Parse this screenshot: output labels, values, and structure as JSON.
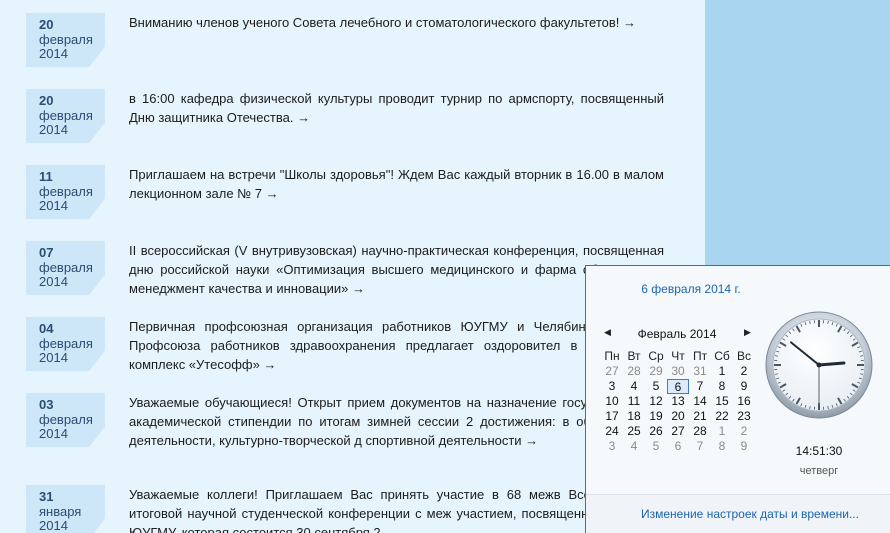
{
  "news": [
    {
      "day": "20",
      "month": "февраля",
      "year": "2014",
      "text": "Вниманию членов ученого Совета лечебного и стоматологического факультетов! →"
    },
    {
      "day": "20",
      "month": "февраля",
      "year": "2014",
      "text": "в 16:00 кафедра физической культуры проводит турнир по армспорту, посвященный Дню защитника Отечества. →"
    },
    {
      "day": "11",
      "month": "февраля",
      "year": "2014",
      "text": "Приглашаем на встречи \"Школы здоровья\"! Ждем Вас каждый вторник в 16.00 в малом лекционном зале № 7 →"
    },
    {
      "day": "07",
      "month": "февраля",
      "year": "2014",
      "text": "II всероссийская (V внутривузовская) научно-практическая конференция, посвященная дню российской науки «Оптимизация высшего медицинского и фарма образования: менеджмент качества и инновации» →"
    },
    {
      "day": "04",
      "month": "февраля",
      "year": "2014",
      "text": "Первичная профсоюзная организация работников ЮУГМУ и Челябински Комитет Профсоюза работников здравоохранения предлагает оздоровител в гостиничный комплекс «Утесофф» →"
    },
    {
      "day": "03",
      "month": "февраля",
      "year": "2014",
      "text": "Уважаемые обучающиеся! Открыт прием документов на назначение государственной академической стипендии по итогам зимней сессии 2 достижения: в общественной деятельности, культурно-творческой д спортивной деятельности →"
    },
    {
      "day": "31",
      "month": "января",
      "year": "2014",
      "text": "Уважаемые коллеги! Приглашаем Вас принять участие в 68 межв Всероссийской) итоговой научной студенческой конференции с меж участием, посвященной 70-летию ЮУГМУ, которая состоится 30 сентября 2"
    }
  ],
  "calendar": {
    "header_date": "6 февраля 2014 г.",
    "month_label": "Февраль 2014",
    "prev_icon": "◀",
    "next_icon": "▶",
    "weekdays": [
      "Пн",
      "Вт",
      "Ср",
      "Чт",
      "Пт",
      "Сб",
      "Вс"
    ],
    "weeks": [
      [
        "27",
        "28",
        "29",
        "30",
        "31",
        "1",
        "2"
      ],
      [
        "3",
        "4",
        "5",
        "6",
        "7",
        "8",
        "9"
      ],
      [
        "10",
        "11",
        "12",
        "13",
        "14",
        "15",
        "16"
      ],
      [
        "17",
        "18",
        "19",
        "20",
        "21",
        "22",
        "23"
      ],
      [
        "24",
        "25",
        "26",
        "27",
        "28",
        "1",
        "2"
      ],
      [
        "3",
        "4",
        "5",
        "6",
        "7",
        "8",
        "9"
      ]
    ],
    "today": "6",
    "time": "14:51:30",
    "weekday_name": "четверг",
    "settings_link": "Изменение настроек даты и времени..."
  },
  "colors": {
    "page_bg": "#e6f4fd",
    "sidebar_bg": "#a9d5f0",
    "badge_bg": "#cde6f8",
    "link": "#1a64b4"
  }
}
